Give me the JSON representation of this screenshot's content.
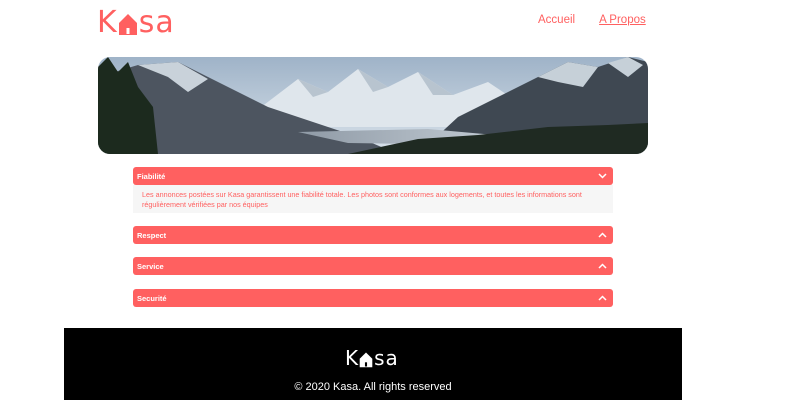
{
  "brand": {
    "logo_k": "K",
    "logo_rest": "sa",
    "color": "#FF6060"
  },
  "nav": {
    "items": [
      {
        "label": "Accueil",
        "active": false
      },
      {
        "label": "A Propos",
        "active": true
      }
    ]
  },
  "banner": {
    "image": "mountain-landscape"
  },
  "collapses": [
    {
      "title": "Fiabilité",
      "expanded": true,
      "icon": "chevron-down-icon",
      "content": "Les annonces postées sur Kasa garantissent une fiabilité totale. Les photos sont conformes aux logements, et toutes les informations sont régulièrement vérifiées par nos équipes"
    },
    {
      "title": "Respect",
      "expanded": false,
      "icon": "chevron-up-icon"
    },
    {
      "title": "Service",
      "expanded": false,
      "icon": "chevron-up-icon"
    },
    {
      "title": "Securité",
      "expanded": false,
      "icon": "chevron-up-icon"
    }
  ],
  "footer": {
    "logo_k": "K",
    "logo_rest": "sa",
    "copyright": "© 2020 Kasa. All rights reserved",
    "background": "#000000"
  }
}
